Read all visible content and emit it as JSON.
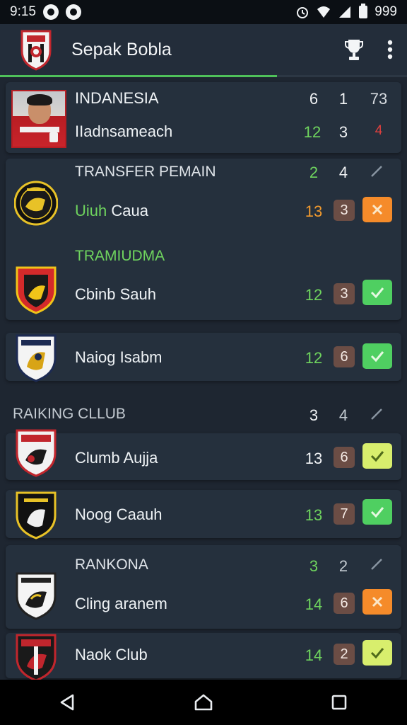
{
  "status_bar": {
    "time": "9:15",
    "battery": "999"
  },
  "app_bar": {
    "title": "Sepak Bobla",
    "progress_percent": 68
  },
  "colors": {
    "green": "#6fd45e",
    "orange": "#f29a2e",
    "accent_line": "#4fc15a",
    "check_green": "#4fcf61",
    "check_lime": "#d8ee6d",
    "cross_orange": "#f58b2a"
  },
  "rows": {
    "r1": {
      "label": "INDANESIA",
      "a": "6",
      "b": "1",
      "c": "73"
    },
    "r2": {
      "label": "IIadnsameach",
      "a": "12",
      "b": "3",
      "c": "4"
    },
    "r3": {
      "label": "TRANSFER PEMAIN",
      "a": "2",
      "b": "4"
    },
    "r4": {
      "label_green": "Uiuh",
      "label": "Caua",
      "a": "13",
      "b": "3"
    },
    "r5": {
      "label": "TRAMIUDMA"
    },
    "r6": {
      "label": "Cbinb Sauh",
      "a": "12",
      "b": "3"
    },
    "r7": {
      "label": "Naiog Isabm",
      "a": "12",
      "b": "6"
    },
    "r8": {
      "label": "RAIKING CLLUB",
      "a": "3",
      "b": "4"
    },
    "r9": {
      "label": "Clumb Aujja",
      "a": "13",
      "b": "6"
    },
    "r10": {
      "label": "Noog Caauh",
      "a": "13",
      "b": "7"
    },
    "r11": {
      "label": "RANKONA",
      "a": "3",
      "b": "2"
    },
    "r12": {
      "label": "Cling aranem",
      "a": "14",
      "b": "6"
    },
    "r13": {
      "label": "Naok Club",
      "a": "14",
      "b": "2"
    }
  }
}
